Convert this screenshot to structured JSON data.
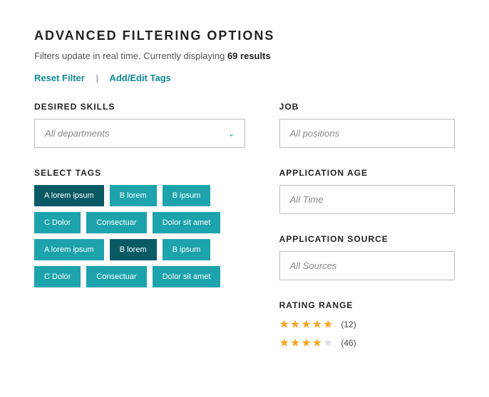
{
  "title": "ADVANCED FILTERING OPTIONS",
  "subtitle_prefix": "Filters update in real time. Currently displaying ",
  "results_count": "69 results",
  "actions": {
    "reset": "Reset Filter",
    "edit": "Add/Edit Tags"
  },
  "skills": {
    "label": "DESIRED SKILLS",
    "placeholder": "All departments"
  },
  "tags": {
    "label": "SELECT TAGS",
    "items": [
      {
        "text": "A lorem ipsum",
        "selected": true
      },
      {
        "text": "B lorem",
        "selected": false
      },
      {
        "text": "B ipsum",
        "selected": false
      },
      {
        "text": "C Dolor",
        "selected": false
      },
      {
        "text": "Consectuar",
        "selected": false
      },
      {
        "text": "Dolor sit amet",
        "selected": false
      },
      {
        "text": "A lorem ipsum",
        "selected": false
      },
      {
        "text": "B lorem",
        "selected": true
      },
      {
        "text": "B ipsum",
        "selected": false
      },
      {
        "text": "C Dolor",
        "selected": false
      },
      {
        "text": "Consectuar",
        "selected": false
      },
      {
        "text": "Dolor sit amet",
        "selected": false
      }
    ]
  },
  "job": {
    "label": "JOB",
    "placeholder": "All positions"
  },
  "age": {
    "label": "APPLICATION AGE",
    "placeholder": "All Time"
  },
  "source": {
    "label": "APPLICATION SOURCE",
    "placeholder": "All Sources"
  },
  "rating": {
    "label": "RATING RANGE",
    "rows": [
      {
        "filled": 5,
        "total": 5,
        "count": "(12)"
      },
      {
        "filled": 4,
        "total": 5,
        "count": "(46)"
      }
    ]
  }
}
